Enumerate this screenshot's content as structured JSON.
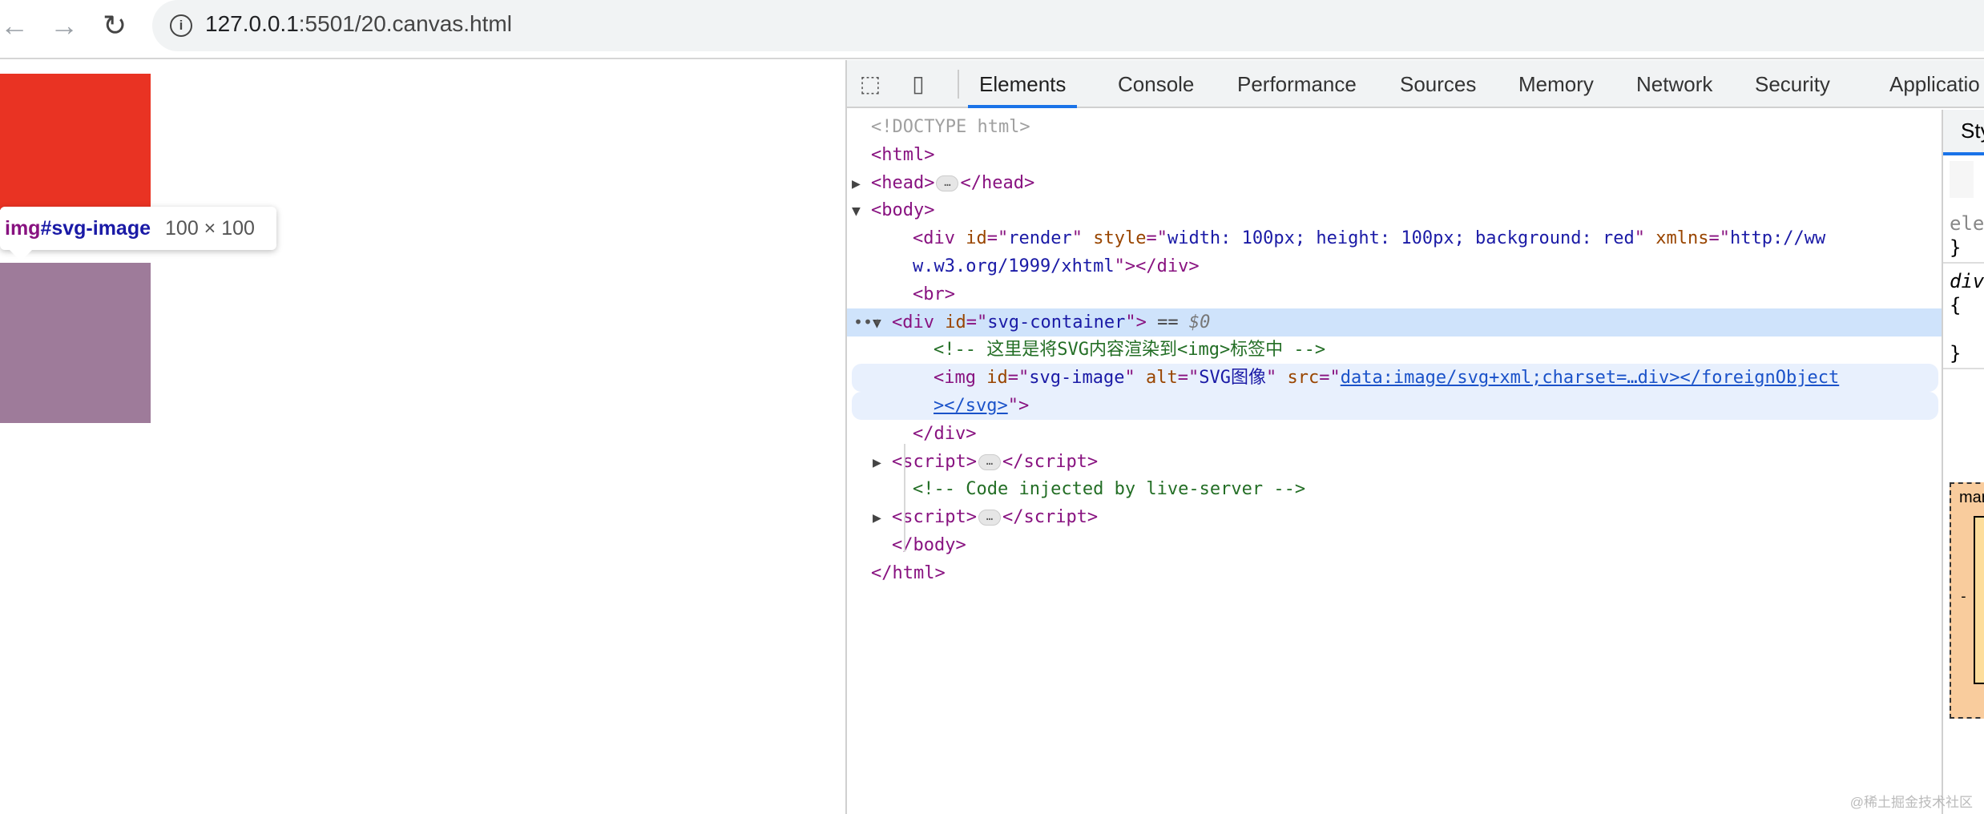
{
  "browser": {
    "url_host": "127.0.0.1",
    "url_rest": ":5501/20.canvas.html",
    "back_icon": "arrow-left-icon",
    "forward_icon": "arrow-right-icon",
    "reload_icon": "reload-icon"
  },
  "viewport": {
    "render_color": "#e93323",
    "image_color": "#9e7b9a",
    "tooltip": {
      "tag": "img",
      "id": "#svg-image",
      "size": "100 × 100"
    }
  },
  "devtools": {
    "tabs": [
      "Elements",
      "Console",
      "Performance",
      "Sources",
      "Memory",
      "Network",
      "Security",
      "Applicatio"
    ],
    "active_tab": "Elements",
    "styles_tab": "Sty",
    "styles_lines": [
      "ele",
      "}",
      "div",
      "{",
      "}"
    ],
    "box_model_label": "mar",
    "box_model_dash": "-",
    "tree": [
      {
        "indent": 0,
        "tokens": [
          [
            "doc",
            "<!DOCTYPE html>"
          ]
        ]
      },
      {
        "indent": 0,
        "tokens": [
          [
            "tag",
            "<html>"
          ]
        ]
      },
      {
        "indent": 0,
        "tri": "▶",
        "tokens": [
          [
            "tag",
            "<head>"
          ],
          [
            "ell",
            "…"
          ],
          [
            "tag",
            "</head>"
          ]
        ]
      },
      {
        "indent": 0,
        "tri": "▼",
        "tokens": [
          [
            "tag",
            "<body>"
          ]
        ]
      },
      {
        "indent": 2,
        "tokens": [
          [
            "tag",
            "<div "
          ],
          [
            "attr",
            "id"
          ],
          [
            "tag",
            "=\""
          ],
          [
            "val",
            "render"
          ],
          [
            "tag",
            "\" "
          ],
          [
            "attr",
            "style"
          ],
          [
            "tag",
            "=\""
          ],
          [
            "val",
            "width: 100px; height: 100px; background: red"
          ],
          [
            "tag",
            "\" "
          ],
          [
            "attr",
            "xmlns"
          ],
          [
            "tag",
            "=\""
          ],
          [
            "val",
            "http://ww"
          ]
        ]
      },
      {
        "indent": 2,
        "tokens": [
          [
            "val",
            "w.w3.org/1999/xhtml"
          ],
          [
            "tag",
            "\"></div>"
          ]
        ]
      },
      {
        "indent": 2,
        "tokens": [
          [
            "tag",
            "<br>"
          ]
        ]
      },
      {
        "indent": 1,
        "tri": "▼",
        "sel": true,
        "tokens": [
          [
            "tag",
            "<div "
          ],
          [
            "attr",
            "id"
          ],
          [
            "tag",
            "=\""
          ],
          [
            "val",
            "svg-container"
          ],
          [
            "tag",
            "\">"
          ],
          [
            "eq",
            " == "
          ],
          [
            "sel",
            "$0"
          ]
        ]
      },
      {
        "indent": 3,
        "tokens": [
          [
            "cmt",
            "<!-- 这里是将SVG内容渲染到<img>标签中 -->"
          ]
        ]
      },
      {
        "indent": 3,
        "hov": true,
        "tokens": [
          [
            "tag",
            "<img "
          ],
          [
            "attr",
            "id"
          ],
          [
            "tag",
            "=\""
          ],
          [
            "val",
            "svg-image"
          ],
          [
            "tag",
            "\" "
          ],
          [
            "attr",
            "alt"
          ],
          [
            "tag",
            "=\""
          ],
          [
            "val",
            "SVG图像"
          ],
          [
            "tag",
            "\" "
          ],
          [
            "attr",
            "src"
          ],
          [
            "tag",
            "=\""
          ],
          [
            "link",
            "data:image/svg+xml;charset=…div></foreignObject"
          ]
        ]
      },
      {
        "indent": 3,
        "hov": true,
        "tokens": [
          [
            "link",
            "></svg>"
          ],
          [
            "tag",
            "\">"
          ]
        ]
      },
      {
        "indent": 2,
        "tokens": [
          [
            "tag",
            "</div>"
          ]
        ]
      },
      {
        "indent": 1,
        "tri": "▶",
        "tokens": [
          [
            "tag",
            "<script>"
          ],
          [
            "ell",
            "…"
          ],
          [
            "tag",
            "</script>"
          ]
        ]
      },
      {
        "indent": 2,
        "tokens": [
          [
            "cmt",
            "<!-- Code injected by live-server -->"
          ]
        ]
      },
      {
        "indent": 1,
        "tri": "▶",
        "tokens": [
          [
            "tag",
            "<script>"
          ],
          [
            "ell",
            "…"
          ],
          [
            "tag",
            "</script>"
          ]
        ]
      },
      {
        "indent": 1,
        "tokens": [
          [
            "tag",
            "</body>"
          ]
        ]
      },
      {
        "indent": 0,
        "tokens": [
          [
            "tag",
            "</html>"
          ]
        ]
      }
    ],
    "selected_dots": "•••"
  },
  "watermark": "@稀土掘金技术社区"
}
